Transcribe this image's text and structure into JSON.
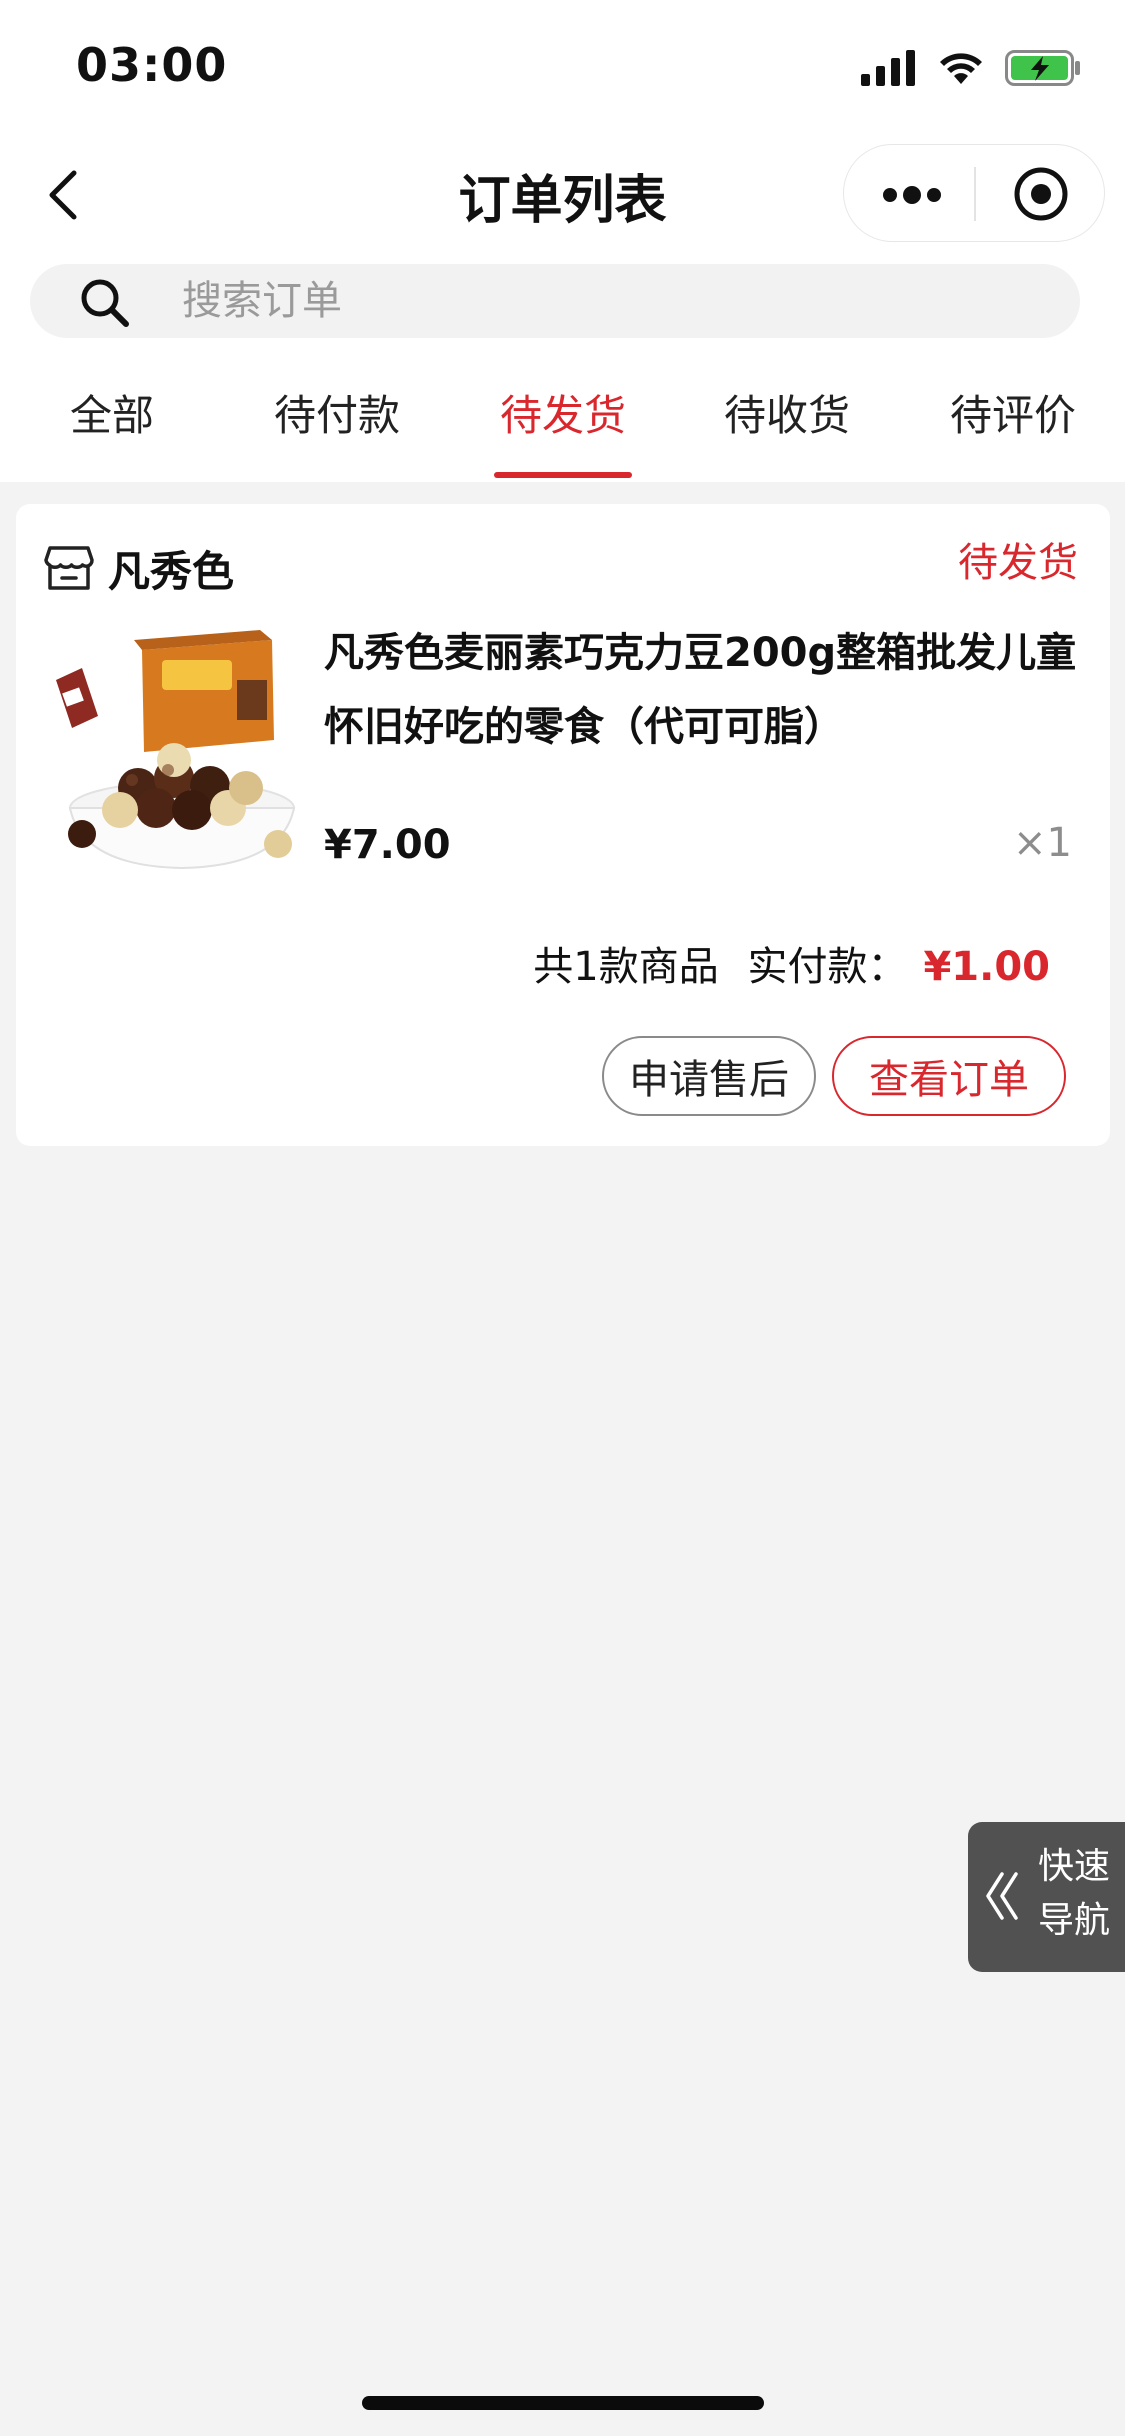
{
  "status_bar": {
    "time": "03:00",
    "icons": [
      "signal-icon",
      "wifi-icon",
      "battery-charging-icon"
    ],
    "battery_color": "#3fc34a"
  },
  "nav": {
    "title": "订单列表",
    "back_icon": "chevron-left-icon",
    "capsule_icons": [
      "more-dots-icon",
      "close-target-icon"
    ]
  },
  "search": {
    "placeholder": "搜索订单",
    "icon": "search-icon"
  },
  "tabs": [
    {
      "label": "全部",
      "active": false
    },
    {
      "label": "待付款",
      "active": false
    },
    {
      "label": "待发货",
      "active": true
    },
    {
      "label": "待收货",
      "active": false
    },
    {
      "label": "待评价",
      "active": false
    }
  ],
  "order": {
    "shop_name": "凡秀色",
    "shop_icon": "store-icon",
    "status": "待发货",
    "product": {
      "title": "凡秀色麦丽素巧克力豆200g整箱批发儿童怀旧好吃的零食（代可可脂）",
      "price": "¥7.00",
      "quantity": "×1"
    },
    "summary": {
      "count_text": "共1款商品",
      "paid_label": "实付款：",
      "paid_amount": "¥1.00"
    },
    "buttons": {
      "after_sale": "申请售后",
      "view_order": "查看订单"
    }
  },
  "quick_nav": {
    "line1": "快速",
    "line2": "导航",
    "icon": "double-chevron-left-icon"
  },
  "colors": {
    "accent": "#d9272e",
    "background": "#f3f3f3",
    "card": "#ffffff"
  }
}
